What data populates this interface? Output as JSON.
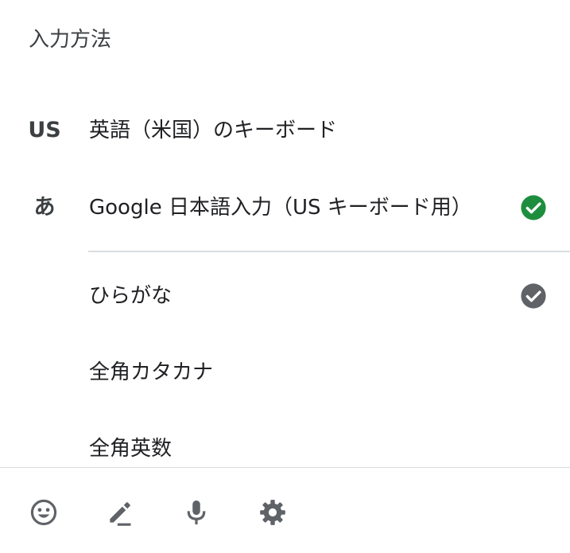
{
  "panel": {
    "title": "入力方法"
  },
  "languages": [
    {
      "badge": "US",
      "label": "英語（米国）のキーボード",
      "selected": false
    },
    {
      "badge": "あ",
      "label": "Google 日本語入力（US キーボード用）",
      "selected": true,
      "check_color": "#1e8e3e"
    }
  ],
  "input_modes": [
    {
      "label": "ひらがな",
      "selected": true,
      "check_color": "#5f6368"
    },
    {
      "label": "全角カタカナ",
      "selected": false
    },
    {
      "label": "全角英数",
      "selected": false
    }
  ],
  "toolbar": {
    "icons": [
      "emoji-icon",
      "pencil-icon",
      "microphone-icon",
      "settings-gear-icon"
    ],
    "icon_color": "#5f6368"
  }
}
